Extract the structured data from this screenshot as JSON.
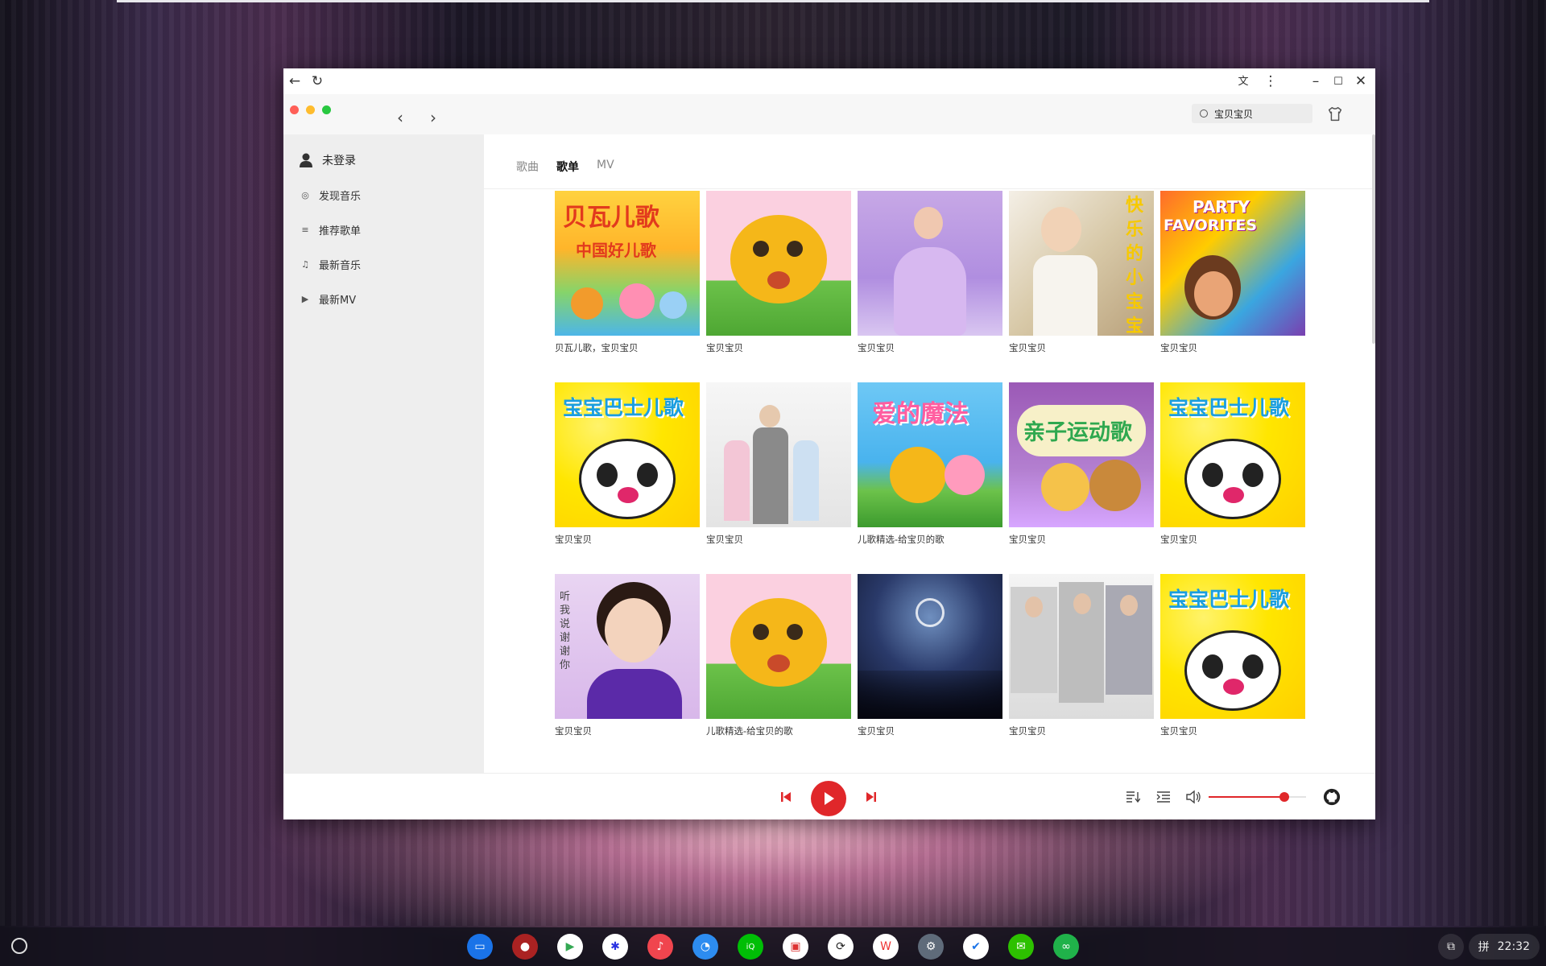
{
  "app": {
    "search": {
      "value": "宝贝宝贝"
    }
  },
  "sidebar": {
    "user": "未登录",
    "items": [
      {
        "label": "发现音乐",
        "icon": "disc-icon"
      },
      {
        "label": "推荐歌单",
        "icon": "playlist-icon"
      },
      {
        "label": "最新音乐",
        "icon": "music-note-icon"
      },
      {
        "label": "最新MV",
        "icon": "video-icon"
      }
    ]
  },
  "tabs": [
    {
      "label": "歌曲",
      "active": false
    },
    {
      "label": "歌单",
      "active": true
    },
    {
      "label": "MV",
      "active": false
    }
  ],
  "playlists": [
    {
      "title": "贝瓦儿歌，宝贝宝贝",
      "cover": "beiwa",
      "cover_text": [
        "贝瓦儿歌",
        "中国好儿歌"
      ]
    },
    {
      "title": "宝贝宝贝",
      "cover": "beaver"
    },
    {
      "title": "宝贝宝贝",
      "cover": "fairy"
    },
    {
      "title": "宝贝宝贝",
      "cover": "boy",
      "cover_text": [
        "快乐的小宝宝"
      ]
    },
    {
      "title": "宝贝宝贝",
      "cover": "dora",
      "cover_text": [
        "PARTY",
        "FAVORITES"
      ]
    },
    {
      "title": "宝贝宝贝",
      "cover": "panda",
      "cover_text": [
        "宝宝巴士儿歌"
      ]
    },
    {
      "title": "宝贝宝贝",
      "cover": "family"
    },
    {
      "title": "儿歌精选-给宝贝的歌",
      "cover": "magic",
      "cover_text": [
        "爱的魔法"
      ]
    },
    {
      "title": "宝贝宝贝",
      "cover": "sport",
      "cover_text": [
        "亲子运动歌"
      ]
    },
    {
      "title": "宝贝宝贝",
      "cover": "panda",
      "cover_text": [
        "宝宝巴士儿歌"
      ]
    },
    {
      "title": "宝贝宝贝",
      "cover": "girl",
      "cover_text": [
        "听我说谢谢你"
      ]
    },
    {
      "title": "儿歌精选-给宝贝的歌",
      "cover": "beaver"
    },
    {
      "title": "宝贝宝贝",
      "cover": "concert"
    },
    {
      "title": "宝贝宝贝",
      "cover": "band"
    },
    {
      "title": "宝贝宝贝",
      "cover": "panda",
      "cover_text": [
        "宝宝巴士儿歌"
      ]
    }
  ],
  "player": {
    "volume": 0.78,
    "accent": "#e0272a"
  },
  "shelf": {
    "apps": [
      "files",
      "chrome",
      "play-store",
      "baidu",
      "music",
      "browser",
      "iqiyi",
      "bag",
      "app-store",
      "wps",
      "settings",
      "tasks",
      "wechat",
      "remote"
    ],
    "ime": "拼",
    "time": "22:32"
  }
}
